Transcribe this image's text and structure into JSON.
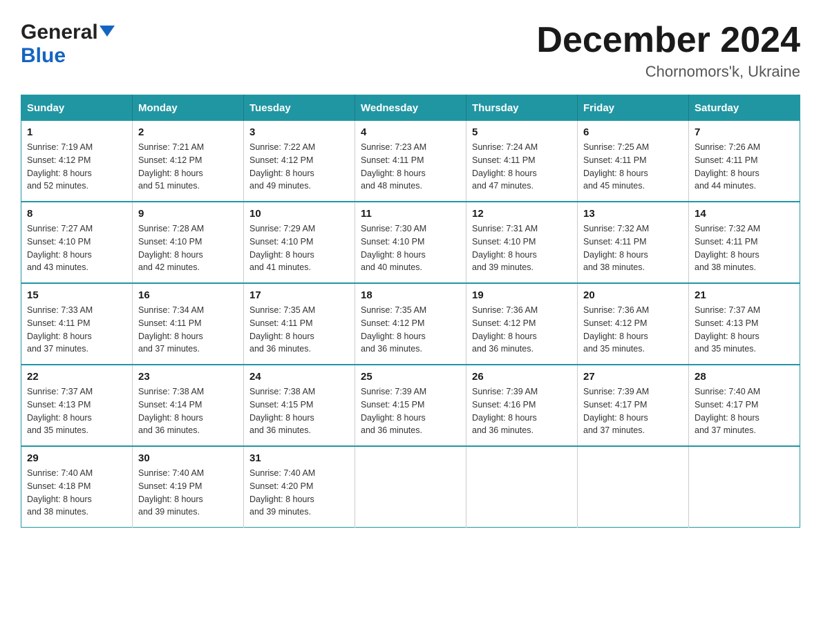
{
  "header": {
    "logo_general": "General",
    "logo_blue": "Blue",
    "month_title": "December 2024",
    "location": "Chornomors'k, Ukraine"
  },
  "days_of_week": [
    "Sunday",
    "Monday",
    "Tuesday",
    "Wednesday",
    "Thursday",
    "Friday",
    "Saturday"
  ],
  "weeks": [
    [
      {
        "day": "1",
        "sunrise": "Sunrise: 7:19 AM",
        "sunset": "Sunset: 4:12 PM",
        "daylight": "Daylight: 8 hours",
        "daylight2": "and 52 minutes."
      },
      {
        "day": "2",
        "sunrise": "Sunrise: 7:21 AM",
        "sunset": "Sunset: 4:12 PM",
        "daylight": "Daylight: 8 hours",
        "daylight2": "and 51 minutes."
      },
      {
        "day": "3",
        "sunrise": "Sunrise: 7:22 AM",
        "sunset": "Sunset: 4:12 PM",
        "daylight": "Daylight: 8 hours",
        "daylight2": "and 49 minutes."
      },
      {
        "day": "4",
        "sunrise": "Sunrise: 7:23 AM",
        "sunset": "Sunset: 4:11 PM",
        "daylight": "Daylight: 8 hours",
        "daylight2": "and 48 minutes."
      },
      {
        "day": "5",
        "sunrise": "Sunrise: 7:24 AM",
        "sunset": "Sunset: 4:11 PM",
        "daylight": "Daylight: 8 hours",
        "daylight2": "and 47 minutes."
      },
      {
        "day": "6",
        "sunrise": "Sunrise: 7:25 AM",
        "sunset": "Sunset: 4:11 PM",
        "daylight": "Daylight: 8 hours",
        "daylight2": "and 45 minutes."
      },
      {
        "day": "7",
        "sunrise": "Sunrise: 7:26 AM",
        "sunset": "Sunset: 4:11 PM",
        "daylight": "Daylight: 8 hours",
        "daylight2": "and 44 minutes."
      }
    ],
    [
      {
        "day": "8",
        "sunrise": "Sunrise: 7:27 AM",
        "sunset": "Sunset: 4:10 PM",
        "daylight": "Daylight: 8 hours",
        "daylight2": "and 43 minutes."
      },
      {
        "day": "9",
        "sunrise": "Sunrise: 7:28 AM",
        "sunset": "Sunset: 4:10 PM",
        "daylight": "Daylight: 8 hours",
        "daylight2": "and 42 minutes."
      },
      {
        "day": "10",
        "sunrise": "Sunrise: 7:29 AM",
        "sunset": "Sunset: 4:10 PM",
        "daylight": "Daylight: 8 hours",
        "daylight2": "and 41 minutes."
      },
      {
        "day": "11",
        "sunrise": "Sunrise: 7:30 AM",
        "sunset": "Sunset: 4:10 PM",
        "daylight": "Daylight: 8 hours",
        "daylight2": "and 40 minutes."
      },
      {
        "day": "12",
        "sunrise": "Sunrise: 7:31 AM",
        "sunset": "Sunset: 4:10 PM",
        "daylight": "Daylight: 8 hours",
        "daylight2": "and 39 minutes."
      },
      {
        "day": "13",
        "sunrise": "Sunrise: 7:32 AM",
        "sunset": "Sunset: 4:11 PM",
        "daylight": "Daylight: 8 hours",
        "daylight2": "and 38 minutes."
      },
      {
        "day": "14",
        "sunrise": "Sunrise: 7:32 AM",
        "sunset": "Sunset: 4:11 PM",
        "daylight": "Daylight: 8 hours",
        "daylight2": "and 38 minutes."
      }
    ],
    [
      {
        "day": "15",
        "sunrise": "Sunrise: 7:33 AM",
        "sunset": "Sunset: 4:11 PM",
        "daylight": "Daylight: 8 hours",
        "daylight2": "and 37 minutes."
      },
      {
        "day": "16",
        "sunrise": "Sunrise: 7:34 AM",
        "sunset": "Sunset: 4:11 PM",
        "daylight": "Daylight: 8 hours",
        "daylight2": "and 37 minutes."
      },
      {
        "day": "17",
        "sunrise": "Sunrise: 7:35 AM",
        "sunset": "Sunset: 4:11 PM",
        "daylight": "Daylight: 8 hours",
        "daylight2": "and 36 minutes."
      },
      {
        "day": "18",
        "sunrise": "Sunrise: 7:35 AM",
        "sunset": "Sunset: 4:12 PM",
        "daylight": "Daylight: 8 hours",
        "daylight2": "and 36 minutes."
      },
      {
        "day": "19",
        "sunrise": "Sunrise: 7:36 AM",
        "sunset": "Sunset: 4:12 PM",
        "daylight": "Daylight: 8 hours",
        "daylight2": "and 36 minutes."
      },
      {
        "day": "20",
        "sunrise": "Sunrise: 7:36 AM",
        "sunset": "Sunset: 4:12 PM",
        "daylight": "Daylight: 8 hours",
        "daylight2": "and 35 minutes."
      },
      {
        "day": "21",
        "sunrise": "Sunrise: 7:37 AM",
        "sunset": "Sunset: 4:13 PM",
        "daylight": "Daylight: 8 hours",
        "daylight2": "and 35 minutes."
      }
    ],
    [
      {
        "day": "22",
        "sunrise": "Sunrise: 7:37 AM",
        "sunset": "Sunset: 4:13 PM",
        "daylight": "Daylight: 8 hours",
        "daylight2": "and 35 minutes."
      },
      {
        "day": "23",
        "sunrise": "Sunrise: 7:38 AM",
        "sunset": "Sunset: 4:14 PM",
        "daylight": "Daylight: 8 hours",
        "daylight2": "and 36 minutes."
      },
      {
        "day": "24",
        "sunrise": "Sunrise: 7:38 AM",
        "sunset": "Sunset: 4:15 PM",
        "daylight": "Daylight: 8 hours",
        "daylight2": "and 36 minutes."
      },
      {
        "day": "25",
        "sunrise": "Sunrise: 7:39 AM",
        "sunset": "Sunset: 4:15 PM",
        "daylight": "Daylight: 8 hours",
        "daylight2": "and 36 minutes."
      },
      {
        "day": "26",
        "sunrise": "Sunrise: 7:39 AM",
        "sunset": "Sunset: 4:16 PM",
        "daylight": "Daylight: 8 hours",
        "daylight2": "and 36 minutes."
      },
      {
        "day": "27",
        "sunrise": "Sunrise: 7:39 AM",
        "sunset": "Sunset: 4:17 PM",
        "daylight": "Daylight: 8 hours",
        "daylight2": "and 37 minutes."
      },
      {
        "day": "28",
        "sunrise": "Sunrise: 7:40 AM",
        "sunset": "Sunset: 4:17 PM",
        "daylight": "Daylight: 8 hours",
        "daylight2": "and 37 minutes."
      }
    ],
    [
      {
        "day": "29",
        "sunrise": "Sunrise: 7:40 AM",
        "sunset": "Sunset: 4:18 PM",
        "daylight": "Daylight: 8 hours",
        "daylight2": "and 38 minutes."
      },
      {
        "day": "30",
        "sunrise": "Sunrise: 7:40 AM",
        "sunset": "Sunset: 4:19 PM",
        "daylight": "Daylight: 8 hours",
        "daylight2": "and 39 minutes."
      },
      {
        "day": "31",
        "sunrise": "Sunrise: 7:40 AM",
        "sunset": "Sunset: 4:20 PM",
        "daylight": "Daylight: 8 hours",
        "daylight2": "and 39 minutes."
      },
      null,
      null,
      null,
      null
    ]
  ]
}
